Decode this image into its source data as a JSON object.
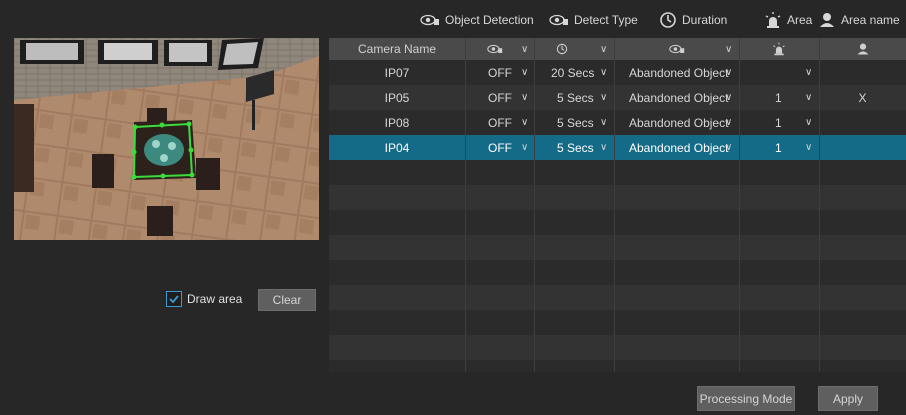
{
  "legend": {
    "object_detection": "Object Detection",
    "detect_type": "Detect Type",
    "duration": "Duration",
    "area": "Area",
    "area_name": "Area name"
  },
  "table": {
    "header": {
      "camera_name": "Camera Name"
    },
    "rows": [
      {
        "camera": "IP07",
        "detection": "OFF",
        "duration": "20 Secs",
        "type": "Abandoned Object",
        "area": "",
        "area_name": ""
      },
      {
        "camera": "IP05",
        "detection": "OFF",
        "duration": "5 Secs",
        "type": "Abandoned Object",
        "area": "1",
        "area_name": "X"
      },
      {
        "camera": "IP08",
        "detection": "OFF",
        "duration": "5 Secs",
        "type": "Abandoned Object",
        "area": "1",
        "area_name": ""
      },
      {
        "camera": "IP04",
        "detection": "OFF",
        "duration": "5 Secs",
        "type": "Abandoned Object",
        "area": "1",
        "area_name": ""
      }
    ]
  },
  "controls": {
    "draw_area_label": "Draw area",
    "draw_area_checked": true,
    "clear_label": "Clear",
    "processing_mode_label": "Processing Mode",
    "apply_label": "Apply"
  },
  "colors": {
    "accent": "#146b87",
    "checkbox": "#3c9ad0",
    "area_outline": "#3ddc3d"
  }
}
